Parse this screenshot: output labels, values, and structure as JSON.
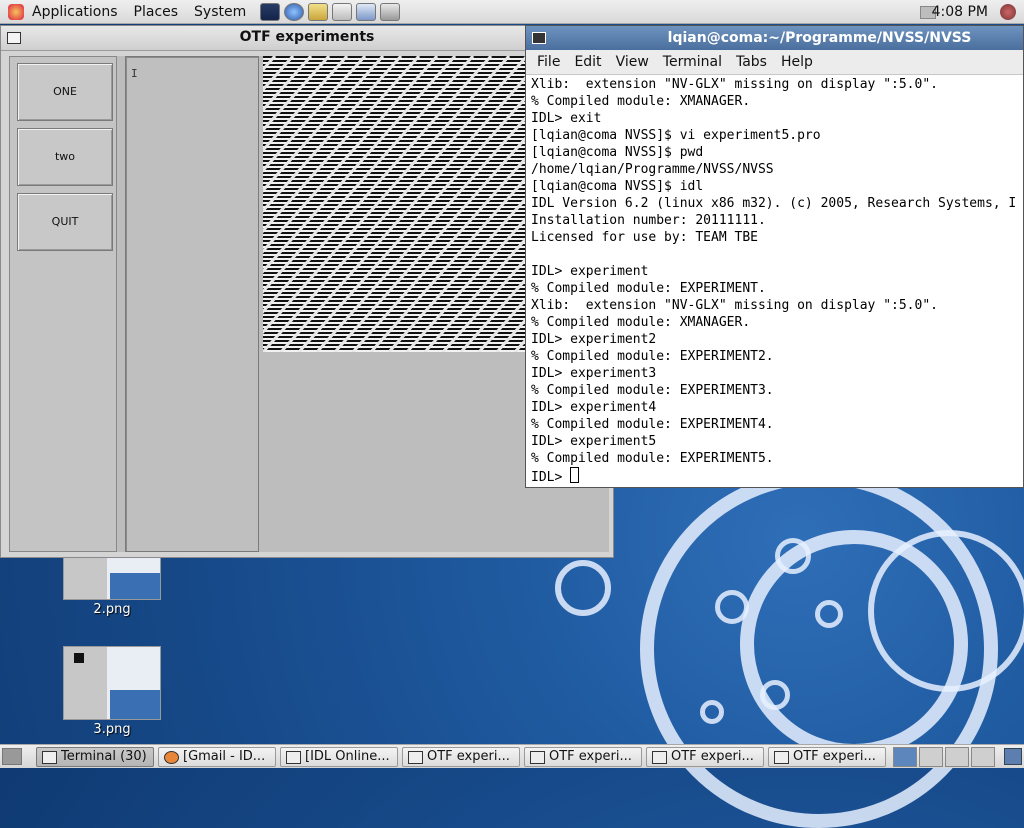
{
  "top_panel": {
    "menus": [
      "Applications",
      "Places",
      "System"
    ],
    "launchers": [
      "terminal-launcher-icon",
      "web-browser-launcher-icon",
      "mail-launcher-icon",
      "text-editor-launcher-icon",
      "notes-launcher-icon",
      "network-launcher-icon"
    ],
    "clock": "4:08 PM"
  },
  "otf_window": {
    "title": "OTF experiments",
    "buttons": [
      "ONE",
      "two",
      "QUIT"
    ],
    "text_cursor": "I"
  },
  "terminal_window": {
    "title": "lqian@coma:~/Programme/NVSS/NVSS",
    "menus": [
      "File",
      "Edit",
      "View",
      "Terminal",
      "Tabs",
      "Help"
    ],
    "lines": [
      "Xlib:  extension \"NV-GLX\" missing on display \":5.0\".",
      "% Compiled module: XMANAGER.",
      "IDL> exit",
      "[lqian@coma NVSS]$ vi experiment5.pro",
      "[lqian@coma NVSS]$ pwd",
      "/home/lqian/Programme/NVSS/NVSS",
      "[lqian@coma NVSS]$ idl",
      "IDL Version 6.2 (linux x86 m32). (c) 2005, Research Systems, I",
      "Installation number: 20111111.",
      "Licensed for use by: TEAM TBE",
      "",
      "IDL> experiment",
      "% Compiled module: EXPERIMENT.",
      "Xlib:  extension \"NV-GLX\" missing on display \":5.0\".",
      "% Compiled module: XMANAGER.",
      "IDL> experiment2",
      "% Compiled module: EXPERIMENT2.",
      "IDL> experiment3",
      "% Compiled module: EXPERIMENT3.",
      "IDL> experiment4",
      "% Compiled module: EXPERIMENT4.",
      "IDL> experiment5",
      "% Compiled module: EXPERIMENT5."
    ],
    "prompt": "IDL> "
  },
  "desktop_icons": [
    {
      "label": "2.png"
    },
    {
      "label": "3.png"
    }
  ],
  "taskbar": {
    "tasks": [
      "Terminal (30)",
      "[Gmail - ID...",
      "[IDL Online...",
      "OTF experi...",
      "OTF experi...",
      "OTF experi...",
      "OTF experi..."
    ]
  },
  "colors": {
    "desktop": "#1f5aa0",
    "terminal_title": "#5a7fae",
    "window_bg": "#d4d4d4"
  }
}
